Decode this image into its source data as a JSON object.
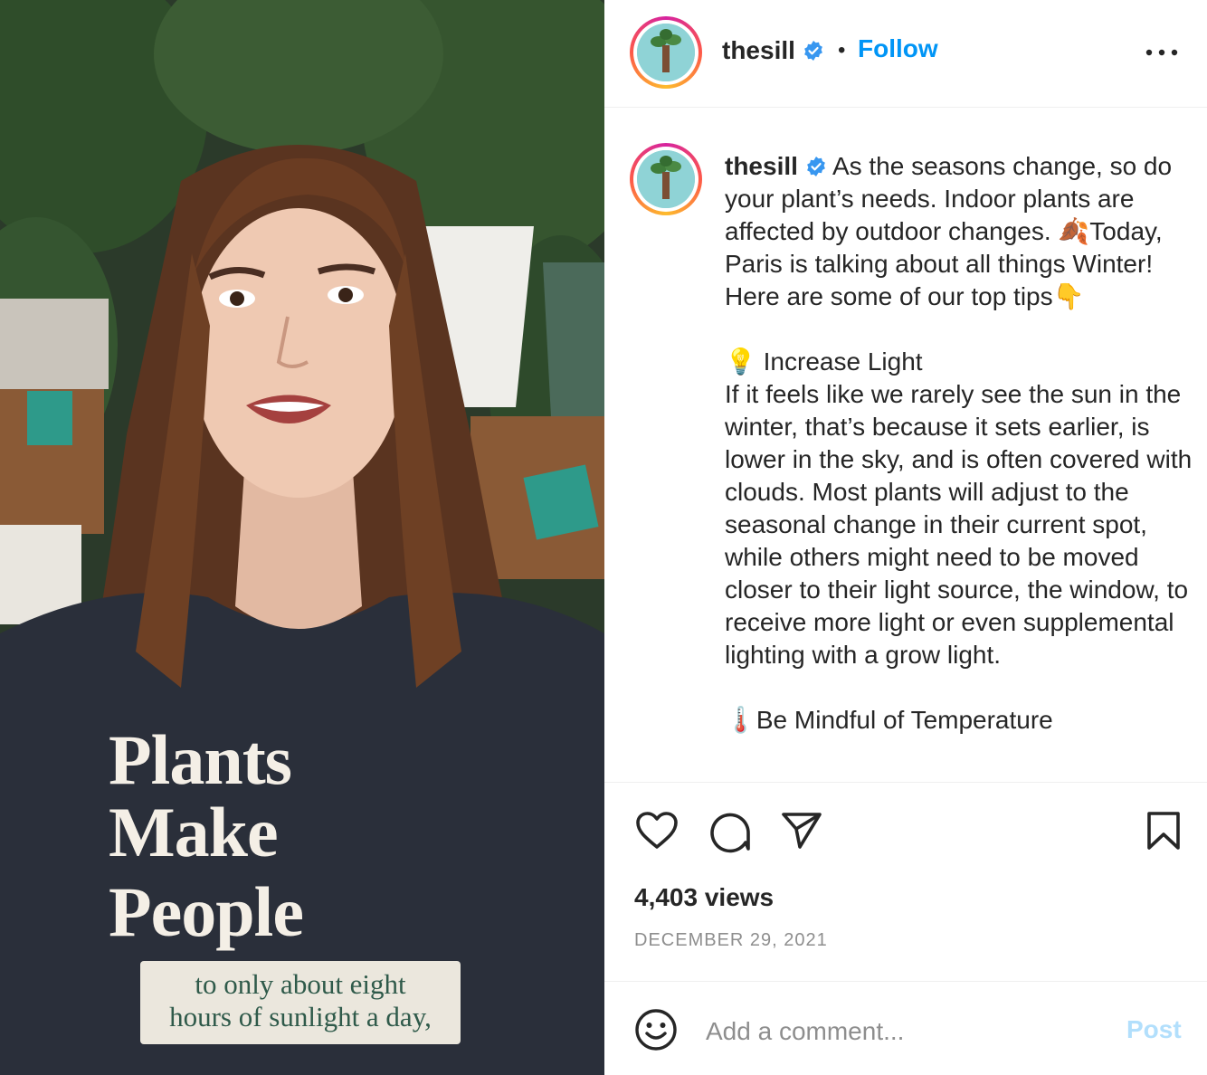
{
  "media": {
    "shirt_lines": [
      "Plants",
      "Make",
      "People"
    ],
    "subtitle_lines": [
      "to only about eight",
      "hours of sunlight a day,"
    ]
  },
  "header": {
    "username": "thesill",
    "separator": "•",
    "follow_label": "Follow",
    "more_icon": "more-horizontal-icon"
  },
  "post": {
    "username": "thesill",
    "caption_intro": "As the seasons change, so do your plant’s needs. Indoor plants are affected by outdoor changes. ",
    "emoji_leaf": "🍂",
    "caption_intro_2": "Today, Paris is talking about all things Winter! Here are some of our top tips",
    "emoji_point": "👇",
    "emoji_bulb": "💡",
    "section1_title": " Increase Light",
    "section1_body": "If it feels like we rarely see the sun in the winter, that’s because it sets earlier, is lower in the sky, and is often covered with clouds. Most plants will adjust to the seasonal change in their current spot, while others might need to be moved closer to their light source, the window, to receive more light or even supplemental lighting with a grow light.",
    "emoji_thermo": "🌡️",
    "section2_title": "Be Mindful of Temperature"
  },
  "actions": {
    "like_icon": "heart-icon",
    "comment_icon": "comment-icon",
    "share_icon": "send-icon",
    "save_icon": "bookmark-icon"
  },
  "stats": {
    "views": "4,403 views",
    "date": "DECEMBER 29, 2021"
  },
  "comment": {
    "placeholder": "Add a comment...",
    "post_label": "Post"
  },
  "colors": {
    "accent": "#0095f6",
    "post_disabled": "#b2dffc",
    "verified": "#3897f0",
    "muted": "#8e8e8e"
  }
}
